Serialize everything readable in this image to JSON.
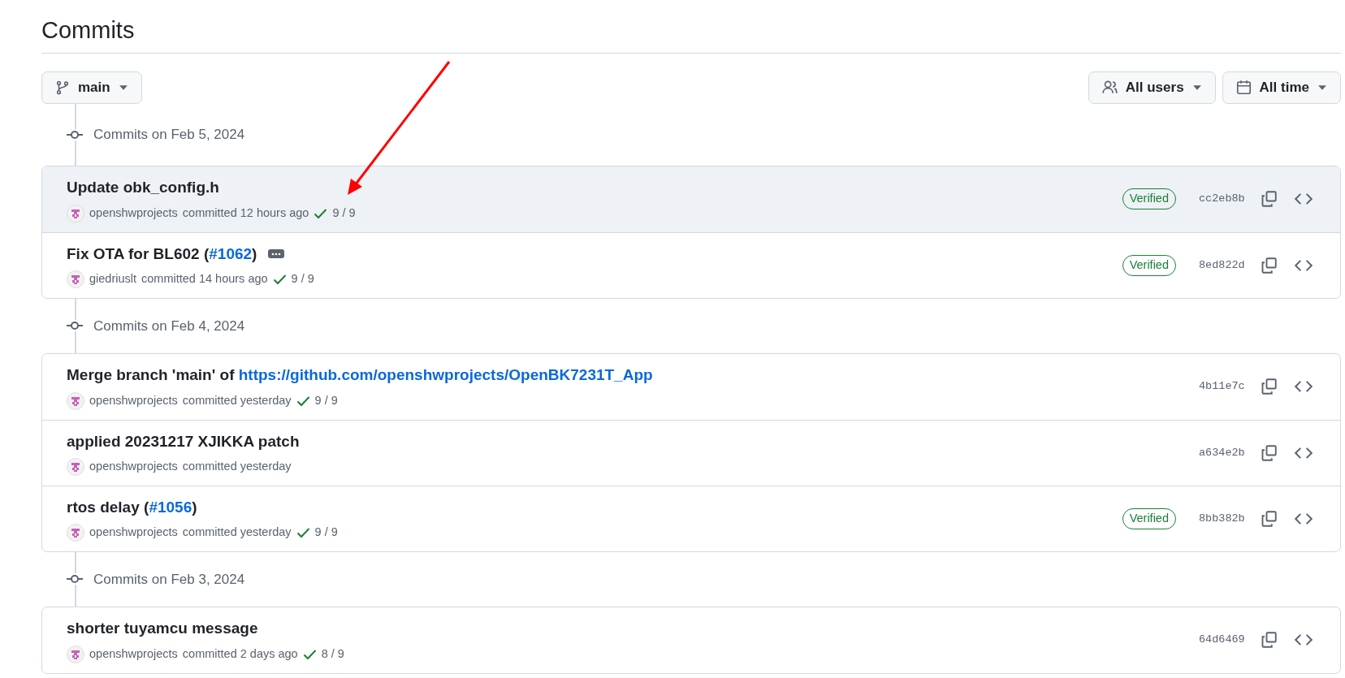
{
  "page_title": "Commits",
  "branch_button": {
    "label": "main"
  },
  "filters": [
    {
      "kind": "users",
      "label": "All users"
    },
    {
      "kind": "time",
      "label": "All time"
    }
  ],
  "groups": [
    {
      "heading": "Commits on Feb 5, 2024",
      "commits": [
        {
          "title": [
            {
              "text": "Update obk_config.h"
            }
          ],
          "has_description": false,
          "highlighted": true,
          "author": "openshwprojects",
          "time": "committed 12 hours ago",
          "checks": "9 / 9",
          "verified": true,
          "verified_label": "Verified",
          "hash": "cc2eb8b"
        },
        {
          "title": [
            {
              "text": "Fix OTA for BL602 ("
            },
            {
              "text": "#1062",
              "link": true
            },
            {
              "text": ")"
            }
          ],
          "has_description": true,
          "highlighted": false,
          "author": "giedriuslt",
          "time": "committed 14 hours ago",
          "checks": "9 / 9",
          "verified": true,
          "verified_label": "Verified",
          "hash": "8ed822d"
        }
      ]
    },
    {
      "heading": "Commits on Feb 4, 2024",
      "commits": [
        {
          "title": [
            {
              "text": "Merge branch 'main' of "
            },
            {
              "text": "https://github.com/openshwprojects/OpenBK7231T_App",
              "link": true
            }
          ],
          "has_description": false,
          "highlighted": false,
          "author": "openshwprojects",
          "time": "committed yesterday",
          "checks": "9 / 9",
          "verified": false,
          "hash": "4b11e7c"
        },
        {
          "title": [
            {
              "text": "applied 20231217 XJIKKA patch"
            }
          ],
          "has_description": false,
          "highlighted": false,
          "author": "openshwprojects",
          "time": "committed yesterday",
          "verified": false,
          "hash": "a634e2b"
        },
        {
          "title": [
            {
              "text": "rtos delay ("
            },
            {
              "text": "#1056",
              "link": true
            },
            {
              "text": ")"
            }
          ],
          "has_description": false,
          "highlighted": false,
          "author": "openshwprojects",
          "time": "committed yesterday",
          "checks": "9 / 9",
          "verified": true,
          "verified_label": "Verified",
          "hash": "8bb382b"
        }
      ]
    },
    {
      "heading": "Commits on Feb 3, 2024",
      "commits": [
        {
          "title": [
            {
              "text": "shorter tuyamcu message"
            }
          ],
          "has_description": false,
          "highlighted": false,
          "author": "openshwprojects",
          "time": "committed 2 days ago",
          "checks": "8 / 9",
          "verified": false,
          "hash": "64d6469"
        }
      ]
    }
  ]
}
